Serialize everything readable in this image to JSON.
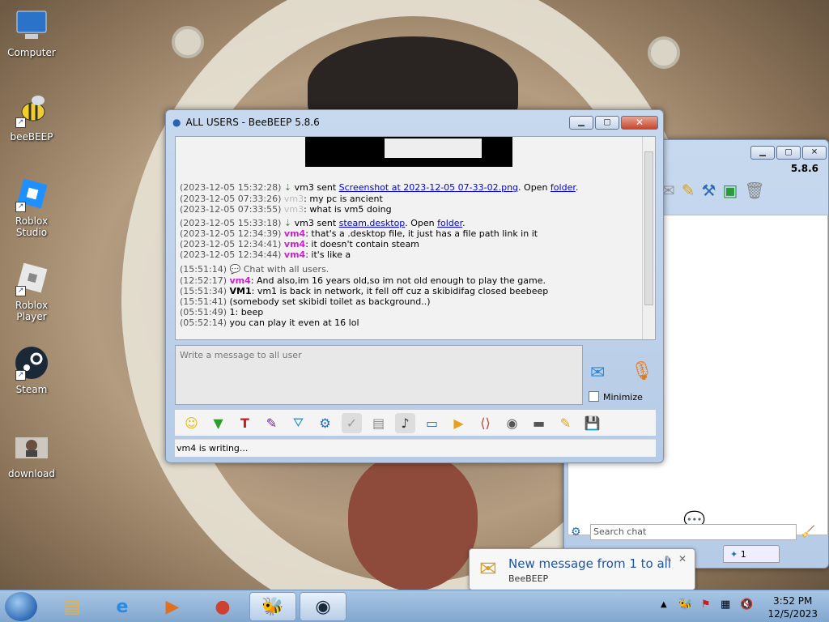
{
  "desktop": {
    "icons": [
      {
        "label": "Computer"
      },
      {
        "label": "beeBEEP"
      },
      {
        "label": "Roblox Studio"
      },
      {
        "label": "Roblox Player"
      },
      {
        "label": "Steam"
      },
      {
        "label": "download"
      }
    ]
  },
  "main_window": {
    "title": "ALL USERS - BeeBEEP 5.8.6",
    "chat_lines": [
      {
        "ts": "(2023-12-05 15:32:28)",
        "pre": " vm3 sent ",
        "link": "Screenshot at 2023-12-05 07-33-02.png",
        "mid": ". Open ",
        "link2": "folder",
        "post": "."
      },
      {
        "ts": "(2023-12-05 07:33:26)",
        "user": "vm3",
        "text": ": my pc is ancient"
      },
      {
        "ts": "(2023-12-05 07:33:55)",
        "user": "vm3",
        "text": ": what is vm5 doing"
      },
      {
        "ts": "(2023-12-05 15:33:18)",
        "pre": " vm3 sent ",
        "link": "steam.desktop",
        "mid": ". Open ",
        "link2": "folder",
        "post": "."
      },
      {
        "ts": "(2023-12-05 12:34:39)",
        "user": "vm4",
        "text": ": that's a .desktop file, it just has a file path link in it"
      },
      {
        "ts": "(2023-12-05 12:34:41)",
        "user": "vm4",
        "text": ": it doesn't contain steam"
      },
      {
        "ts": "(2023-12-05 12:34:44)",
        "user": "vm4",
        "text": ": it's like a "
      },
      {
        "ts": "(15:51:14)",
        "text": " Chat with all users."
      },
      {
        "ts": "(12:52:17)",
        "user": "vm4",
        "text": ": And also,im 16 years old,so im not old enough to play the game."
      },
      {
        "ts": "(15:51:34)",
        "user": "VM1",
        "text": ": vm1 is back in network, it fell off cuz a skibidifag closed beebeep"
      },
      {
        "ts": "(15:51:41)",
        "text": "     (somebody set skibidi toilet as background..)"
      },
      {
        "ts": "(05:51:49)",
        "text": " 1: beep"
      },
      {
        "ts": "(05:52:14)",
        "text": "     you can play it even at 16 lol"
      }
    ],
    "message_placeholder": "Write a message to all user",
    "minimize_label": "Minimize",
    "status_text": "vm4 is writing..."
  },
  "side_window": {
    "version": "5.8.6",
    "search_placeholder": "Search chat",
    "tab_count": "1"
  },
  "notification": {
    "title": "New message from 1 to all",
    "app": "BeeBEEP"
  },
  "taskbar": {
    "time": "3:52 PM",
    "date": "12/5/2023"
  }
}
